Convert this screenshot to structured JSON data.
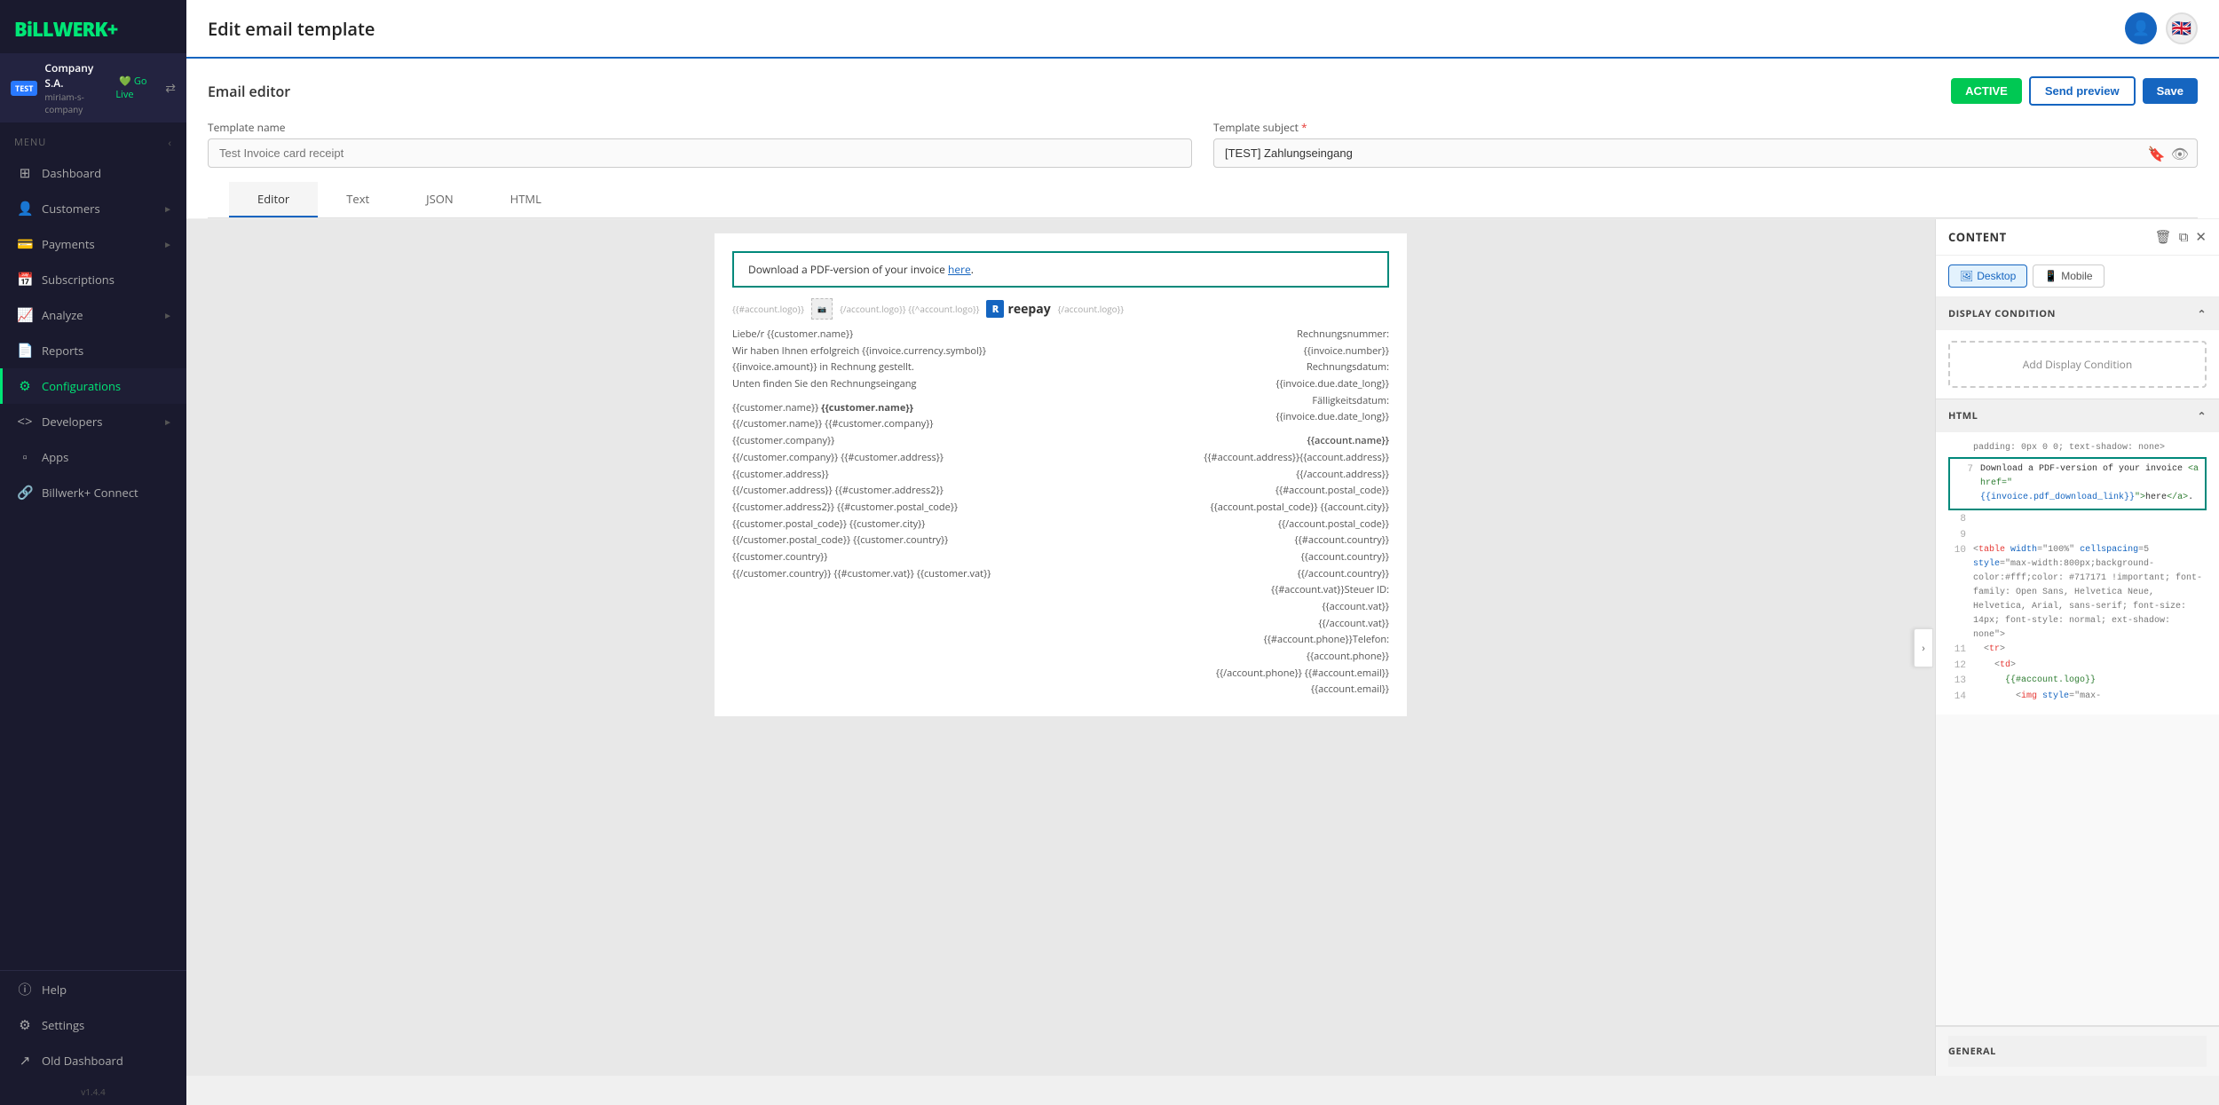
{
  "app": {
    "logo_text": "BiLLWERK",
    "logo_plus": "+",
    "version": "v1.4.4"
  },
  "company": {
    "test_badge": "TEST",
    "name": "Company S.A.",
    "slug": "miriam-s-company",
    "go_live": "⇄ Go Live"
  },
  "sidebar": {
    "menu_label": "Menu",
    "items": [
      {
        "id": "dashboard",
        "label": "Dashboard",
        "icon": "⊞",
        "active": false
      },
      {
        "id": "customers",
        "label": "Customers",
        "icon": "👤",
        "active": false,
        "has_arrow": true
      },
      {
        "id": "payments",
        "label": "Payments",
        "icon": "💳",
        "active": false,
        "has_arrow": true
      },
      {
        "id": "subscriptions",
        "label": "Subscriptions",
        "icon": "📅",
        "active": false
      },
      {
        "id": "analyze",
        "label": "Analyze",
        "icon": "📈",
        "active": false,
        "has_arrow": true
      },
      {
        "id": "reports",
        "label": "Reports",
        "icon": "📄",
        "active": false
      },
      {
        "id": "configurations",
        "label": "Configurations",
        "icon": "⚙",
        "active": true
      },
      {
        "id": "developers",
        "label": "Developers",
        "icon": "<>",
        "active": false,
        "has_arrow": true
      },
      {
        "id": "apps",
        "label": "Apps",
        "icon": "⊞",
        "active": false
      },
      {
        "id": "billwerk-connect",
        "label": "Billwerk+ Connect",
        "icon": "🔗",
        "active": false
      }
    ],
    "bottom_items": [
      {
        "id": "help",
        "label": "Help",
        "icon": "?"
      },
      {
        "id": "settings",
        "label": "Settings",
        "icon": "⚙"
      },
      {
        "id": "old-dashboard",
        "label": "Old Dashboard",
        "icon": "↗"
      }
    ]
  },
  "page": {
    "title": "Edit email template"
  },
  "header": {
    "user_icon": "👤",
    "flag_icon": "🇬🇧"
  },
  "email_editor": {
    "section_title": "Email editor",
    "btn_active": "ACTIVE",
    "btn_send_preview": "Send preview",
    "btn_save": "Save"
  },
  "template_name": {
    "label": "Template name",
    "placeholder": "Test Invoice card receipt",
    "value": ""
  },
  "template_subject": {
    "label": "Template subject",
    "required": true,
    "value": "[TEST] Zahlungseingang"
  },
  "tabs": [
    {
      "id": "editor",
      "label": "Editor",
      "active": true
    },
    {
      "id": "text",
      "label": "Text",
      "active": false
    },
    {
      "id": "json",
      "label": "JSON",
      "active": false
    },
    {
      "id": "html",
      "label": "HTML",
      "active": false
    }
  ],
  "canvas": {
    "highlight_text": "Download a PDF-version of your invoice here.",
    "logo_template": "{{#account.logo}} {/account.logo}} {{^account.logo}}",
    "logo_end": "{/account.logo}}",
    "reepay_text": "reepay",
    "left_content": [
      "Liebe/r {{customer.name}}",
      "Wir haben Ihnen erfolgreich {{invoice.currency.symbol}}",
      "{{invoice.amount}} in Rechnung gestellt.",
      "Unten finden Sie den Rechnungseingang",
      "",
      "{{customer.name}} {{customer.name}}",
      "{{/customer.name}} {{#customer.company}}",
      "{{customer.company}}",
      "{{/customer.company}} {{#customer.address}}",
      "{{customer.address}}",
      "{{/customer.address}} {{#customer.address2}}",
      "{{customer.address2}} {{#customer.postal_code}}",
      "{{customer.postal_code}} {{customer.city}}",
      "{{/customer.postal_code}} {{customer.country}}",
      "{{customer.country}}",
      "{{/customer.country}} {{#customer.vat}} {{customer.vat}}"
    ],
    "right_content": [
      "Rechnungsnummer:",
      "{{invoice.number}}",
      "Rechnungsdatum:",
      "{{invoice.due.date_long}}",
      "Fälligkeitsdatum:",
      "{{invoice.due.date_long}}",
      "",
      "{{account.name}}",
      "{{#account.address}}{{account.address}}",
      "{{/account.address}} {{#account.postal_code}}",
      "{{account.postal_code}} {{account.city}}",
      "{{/account.postal_code}} {{#account.country}}",
      "{{account.country}}",
      "{{/account.country}} {{#account.vat}}Steuer ID:",
      "{{account.vat}}",
      "{{/account.vat}} {{#account.phone}}Telefon:",
      "{{account.phone}}",
      "{{/account.phone}} {{#account.email}}{{account.email}}"
    ]
  },
  "right_panel": {
    "title": "CONTENT",
    "icon_trash": "🗑",
    "icon_copy": "⧉",
    "icon_close": "✕",
    "device_desktop": "Desktop",
    "device_mobile": "Mobile",
    "display_condition_label": "DISPLAY CONDITION",
    "add_condition_text": "Add Display Condition",
    "html_section_label": "HTML",
    "code_lines": [
      {
        "num": "",
        "text": "padding: 0px 0 0; text-shadow: none>"
      },
      {
        "num": "7",
        "text": "Download a PDF-version of your invoice <a href=\"{{invoice.pdf_download_link}}\">here</a>.",
        "highlight": true
      },
      {
        "num": "8",
        "text": ""
      },
      {
        "num": "9",
        "text": ""
      },
      {
        "num": "10",
        "text": "<table width=\"100%\" cellspacing=5 style=\"max-width:800px;background-color:#fff;color: #717171 !important; font-family: Open Sans, Helvetica Neue, Helvetica, Arial, sans-serif; font-size: 14px; font-style: normal; ext-shadow: none\">"
      },
      {
        "num": "11",
        "text": "  <tr>"
      },
      {
        "num": "12",
        "text": "    <td>"
      },
      {
        "num": "13",
        "text": "      {{#account.logo}}"
      },
      {
        "num": "14",
        "text": "        <img style=\"max-"
      }
    ],
    "general_label": "GENERAL"
  }
}
